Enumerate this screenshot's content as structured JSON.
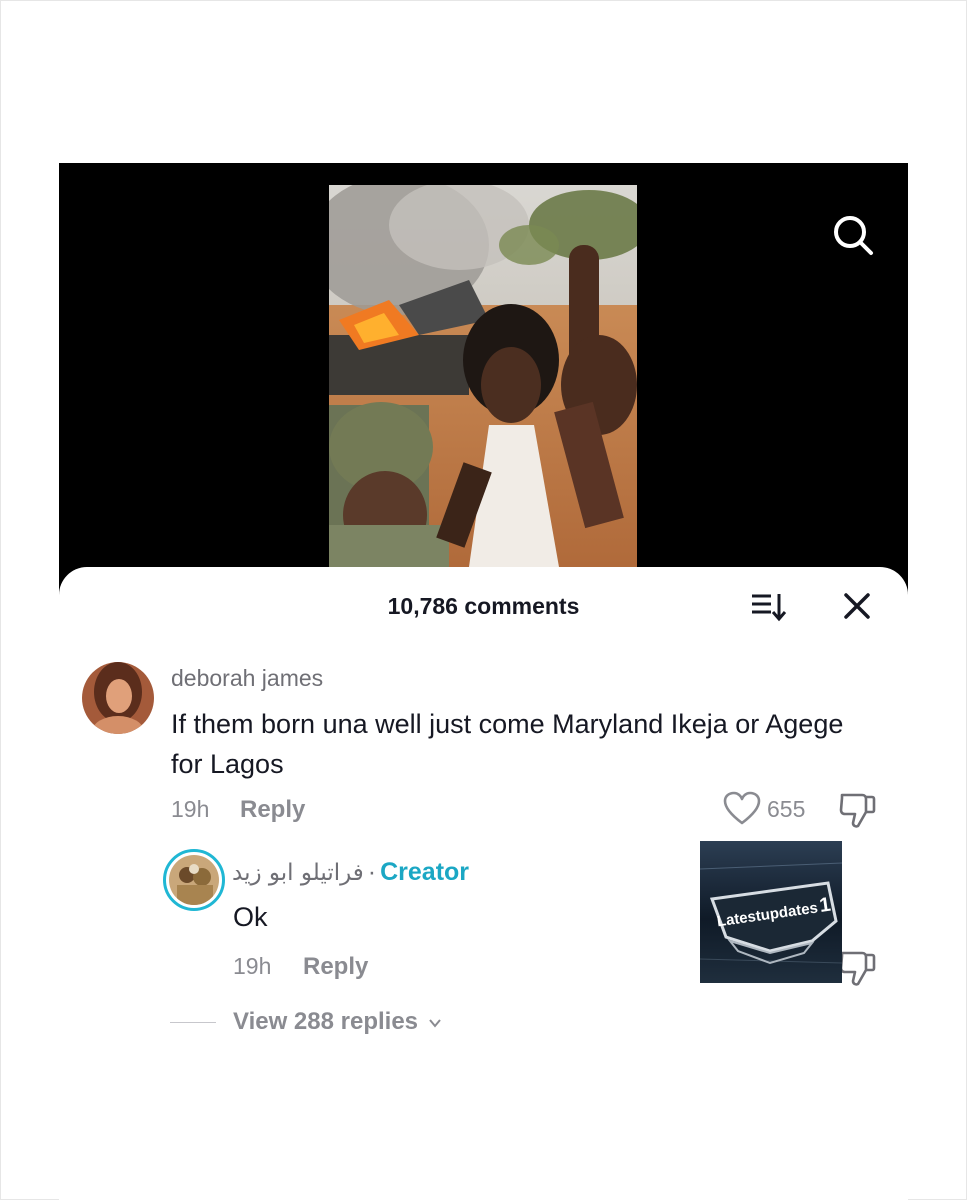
{
  "video": {
    "search_icon": "search-icon"
  },
  "comments_panel": {
    "count_label": "10,786 comments",
    "sort_icon": "sort-icon",
    "close_icon": "close-icon"
  },
  "comment": {
    "username": "deborah james",
    "text": "If them born una well just come Maryland Ikeja or Agege for Lagos",
    "time": "19h",
    "reply_label": "Reply",
    "like_count": "655"
  },
  "reply": {
    "username": "فراتيلو ابو زيد",
    "separator": "·",
    "badge": "Creator",
    "text": "Ok",
    "time": "19h",
    "reply_label": "Reply"
  },
  "view_replies_label": "View 288 replies",
  "watermark": {
    "text": "Latestupdates",
    "number": "1"
  },
  "colors": {
    "creator_accent": "#1ba7c4",
    "muted_text": "#8a8b91"
  }
}
